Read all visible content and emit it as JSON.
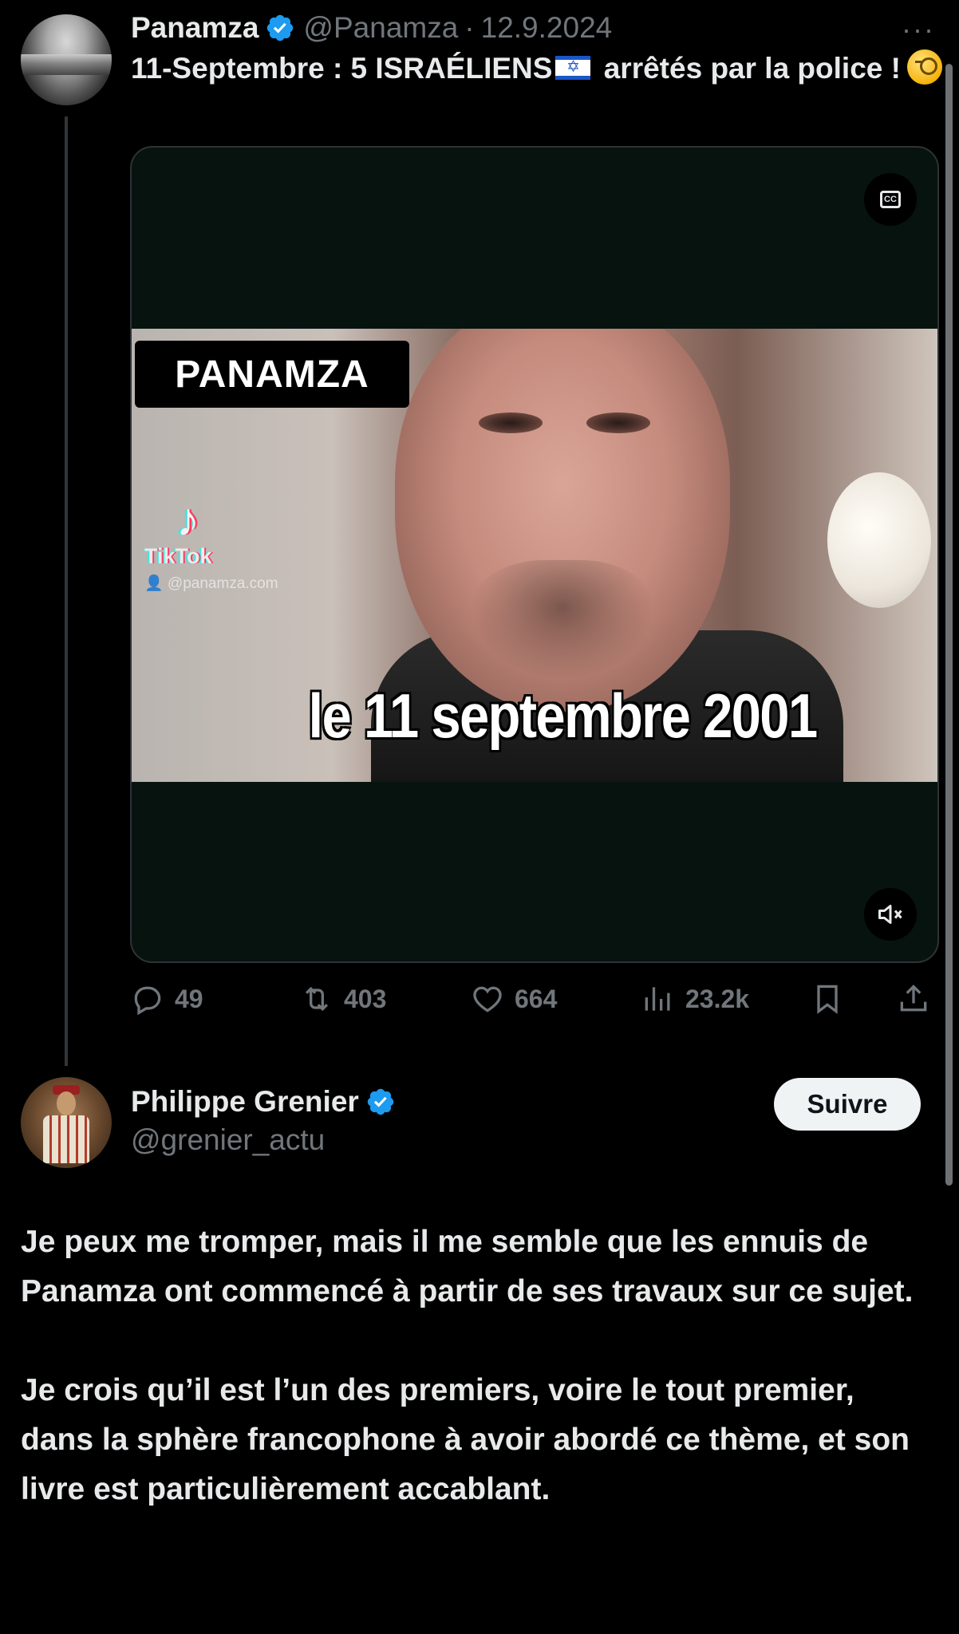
{
  "tweet1": {
    "author_name": "Panamza",
    "handle": "@Panamza",
    "separator": "·",
    "date": "12.9.2024",
    "more": "···",
    "text_before_flag": "11-Septembre : 5 ISRAÉLIENS",
    "text_after_flag": " arrêtés par la police !",
    "video": {
      "overlay_label": "PANAMZA",
      "tiktok_name": "TikTok",
      "tiktok_handle": "👤 @panamza.com",
      "caption": "le 11 septembre 2001",
      "cc_icon_text": "CC"
    },
    "actions": {
      "replies": "49",
      "reposts": "403",
      "likes": "664",
      "views": "23.2k"
    }
  },
  "tweet2": {
    "author_name": "Philippe Grenier",
    "handle": "@grenier_actu",
    "follow_label": "Suivre",
    "paragraph1": "Je peux me tromper, mais il me semble que les ennuis de Panamza ont commencé à partir de ses travaux sur ce sujet.",
    "paragraph2": "Je crois qu’il est l’un des premiers, voire le tout premier, dans la sphère francophone à avoir abordé ce thème, et son livre est particulièrement accablant."
  },
  "colors": {
    "background": "#000000",
    "text": "#e7e9ea",
    "muted": "#71767b",
    "verified": "#1d9bf0",
    "border": "#2f3336"
  },
  "icons": [
    "verified-badge-icon",
    "more-icon",
    "israel-flag-icon",
    "face-with-monocle-emoji",
    "closed-captions-icon",
    "mute-icon",
    "reply-icon",
    "repost-icon",
    "like-icon",
    "views-icon",
    "bookmark-icon",
    "share-icon",
    "tiktok-icon"
  ]
}
